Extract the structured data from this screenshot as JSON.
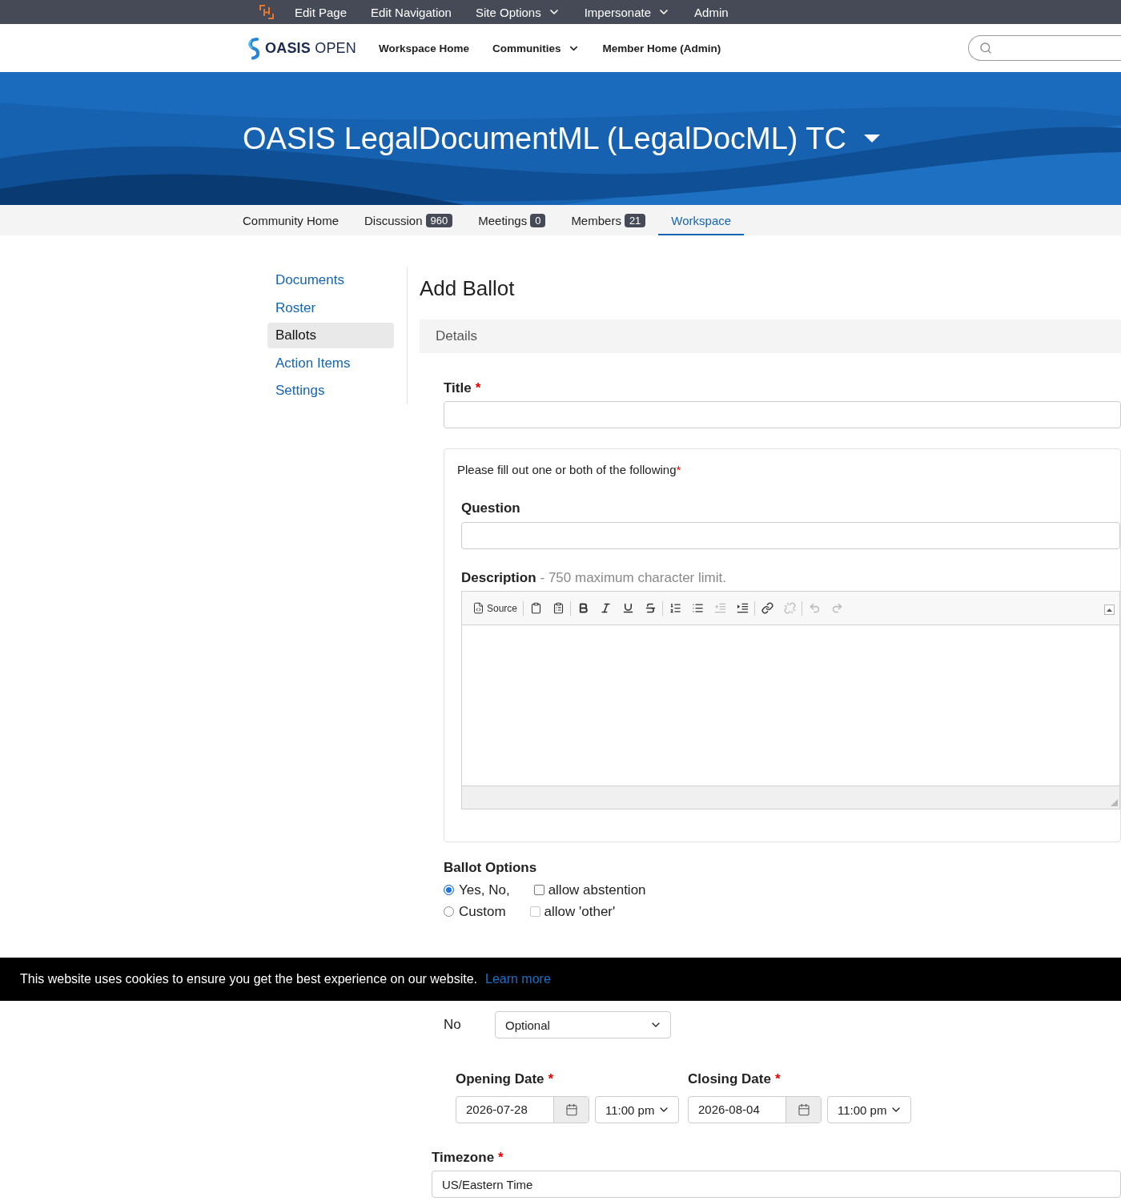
{
  "admin_bar": {
    "items": [
      {
        "label": "Edit Page",
        "menu": false
      },
      {
        "label": "Edit Navigation",
        "menu": false
      },
      {
        "label": "Site Options",
        "menu": true
      },
      {
        "label": "Impersonate",
        "menu": true
      },
      {
        "label": "Admin",
        "menu": false
      }
    ]
  },
  "header": {
    "logo": "**OASIS** OPEN",
    "nav": [
      {
        "label": "Workspace Home",
        "menu": false
      },
      {
        "label": "Communities",
        "menu": true
      },
      {
        "label": "Member Home (Admin)",
        "menu": false
      }
    ]
  },
  "banner": {
    "title": "OASIS LegalDocumentML (LegalDocML) TC",
    "menu": true
  },
  "tabs": [
    {
      "label": "Community Home",
      "selected": false
    },
    {
      "label": "Discussion",
      "badge": "960",
      "selected": false
    },
    {
      "label": "Meetings",
      "badge": "0",
      "selected": false
    },
    {
      "label": "Members",
      "badge": "21",
      "selected": false
    },
    {
      "label": "Workspace",
      "selected": true
    }
  ],
  "sidebar": {
    "items": [
      {
        "label": "Documents",
        "selected": false
      },
      {
        "label": "Roster",
        "selected": false
      },
      {
        "label": "Ballots",
        "selected": true
      },
      {
        "label": "Action Items",
        "selected": false
      },
      {
        "label": "Settings",
        "selected": false
      }
    ]
  },
  "page": {
    "title": "Add Ballot",
    "section": "Details"
  },
  "form": {
    "title": {
      "label": "Title",
      "required_mark": "*"
    },
    "content_group": {
      "note": "Please fill out one or both of the following",
      "required_mark": "*",
      "question": {
        "label": "Question"
      },
      "description": {
        "label": "Description",
        "hint": "- 750 maximum character limit.",
        "toolbar": [
          {
            "buttons": [
              {
                "kind": "source",
                "label": "Source",
                "disabled": false
              }
            ]
          },
          {
            "buttons": [
              {
                "kind": "paste-word",
                "disabled": false
              },
              {
                "kind": "paste-text",
                "disabled": false
              }
            ]
          },
          {
            "buttons": [
              {
                "kind": "bold",
                "disabled": false
              },
              {
                "kind": "italic",
                "disabled": false
              },
              {
                "kind": "underline",
                "disabled": false
              },
              {
                "kind": "strike",
                "disabled": false
              }
            ]
          },
          {
            "buttons": [
              {
                "kind": "numbered-list",
                "disabled": false
              },
              {
                "kind": "bulleted-list",
                "disabled": false
              },
              {
                "kind": "outdent",
                "disabled": true
              },
              {
                "kind": "indent",
                "disabled": false
              }
            ]
          },
          {
            "buttons": [
              {
                "kind": "link",
                "disabled": false
              },
              {
                "kind": "unlink",
                "disabled": true
              }
            ]
          },
          {
            "buttons": [
              {
                "kind": "undo",
                "disabled": true
              },
              {
                "kind": "redo",
                "disabled": true
              }
            ]
          }
        ]
      }
    },
    "ballot_options": {
      "label": "Ballot Options",
      "rows": [
        {
          "radio": {
            "label": "Yes, No,",
            "selected": true
          },
          "checkbox": {
            "label": "allow abstention",
            "checked": false,
            "disabled": false
          }
        },
        {
          "radio": {
            "label": "Custom",
            "selected": false
          },
          "checkbox": {
            "label": "allow 'other'",
            "checked": false,
            "disabled": true
          }
        }
      ]
    },
    "commenting": {
      "rows": [
        {
          "label": "No",
          "value": "Optional"
        }
      ]
    },
    "dates": [
      {
        "label": "Opening Date",
        "required_mark": "*",
        "date": "2026-07-28",
        "time": "11:00 pm"
      },
      {
        "label": "Closing Date",
        "required_mark": "*",
        "date": "2026-08-04",
        "time": "11:00 pm"
      }
    ],
    "timezone": {
      "label": "Timezone",
      "required_mark": "*",
      "value": "US/Eastern Time"
    }
  },
  "cookie_banner": {
    "text": "This website uses cookies to ensure you get the best experience on our website.",
    "link": "Learn more"
  }
}
